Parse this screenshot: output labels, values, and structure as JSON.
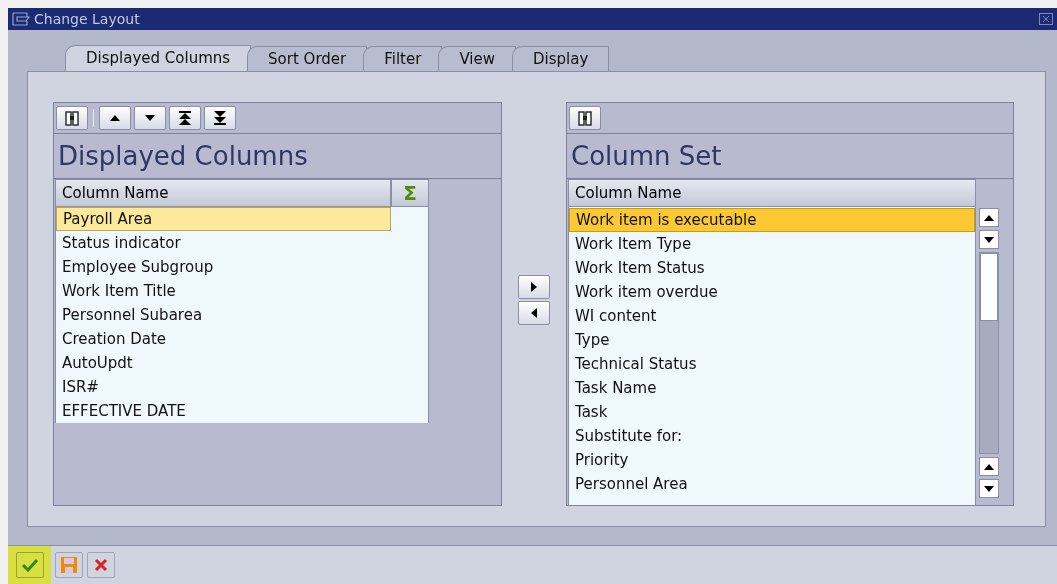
{
  "window": {
    "title": "Change Layout"
  },
  "tabs": [
    {
      "label": "Displayed Columns",
      "selected": true
    },
    {
      "label": "Sort Order",
      "selected": false
    },
    {
      "label": "Filter",
      "selected": false
    },
    {
      "label": "View",
      "selected": false
    },
    {
      "label": "Display",
      "selected": false
    }
  ],
  "displayed_columns": {
    "title": "Displayed Columns",
    "column_header": "Column Name",
    "sum_header": "Σ",
    "rows": [
      {
        "label": "Payroll Area",
        "selected": true
      },
      {
        "label": "Status indicator",
        "selected": false
      },
      {
        "label": "Employee Subgroup",
        "selected": false
      },
      {
        "label": "Work Item Title",
        "selected": false
      },
      {
        "label": "Personnel Subarea",
        "selected": false
      },
      {
        "label": "Creation Date",
        "selected": false
      },
      {
        "label": "AutoUpdt",
        "selected": false
      },
      {
        "label": "ISR#",
        "selected": false
      },
      {
        "label": "EFFECTIVE DATE",
        "selected": false
      }
    ]
  },
  "column_set": {
    "title": "Column Set",
    "column_header": "Column Name",
    "rows": [
      {
        "label": "Work item is executable",
        "selected": true
      },
      {
        "label": "Work Item Type",
        "selected": false
      },
      {
        "label": "Work Item Status",
        "selected": false
      },
      {
        "label": "Work item overdue",
        "selected": false
      },
      {
        "label": "WI content",
        "selected": false
      },
      {
        "label": "Type",
        "selected": false
      },
      {
        "label": "Technical Status",
        "selected": false
      },
      {
        "label": "Task Name",
        "selected": false
      },
      {
        "label": "Task",
        "selected": false
      },
      {
        "label": "Substitute for:",
        "selected": false
      },
      {
        "label": "Priority",
        "selected": false
      },
      {
        "label": "Personnel Area",
        "selected": false
      }
    ]
  }
}
